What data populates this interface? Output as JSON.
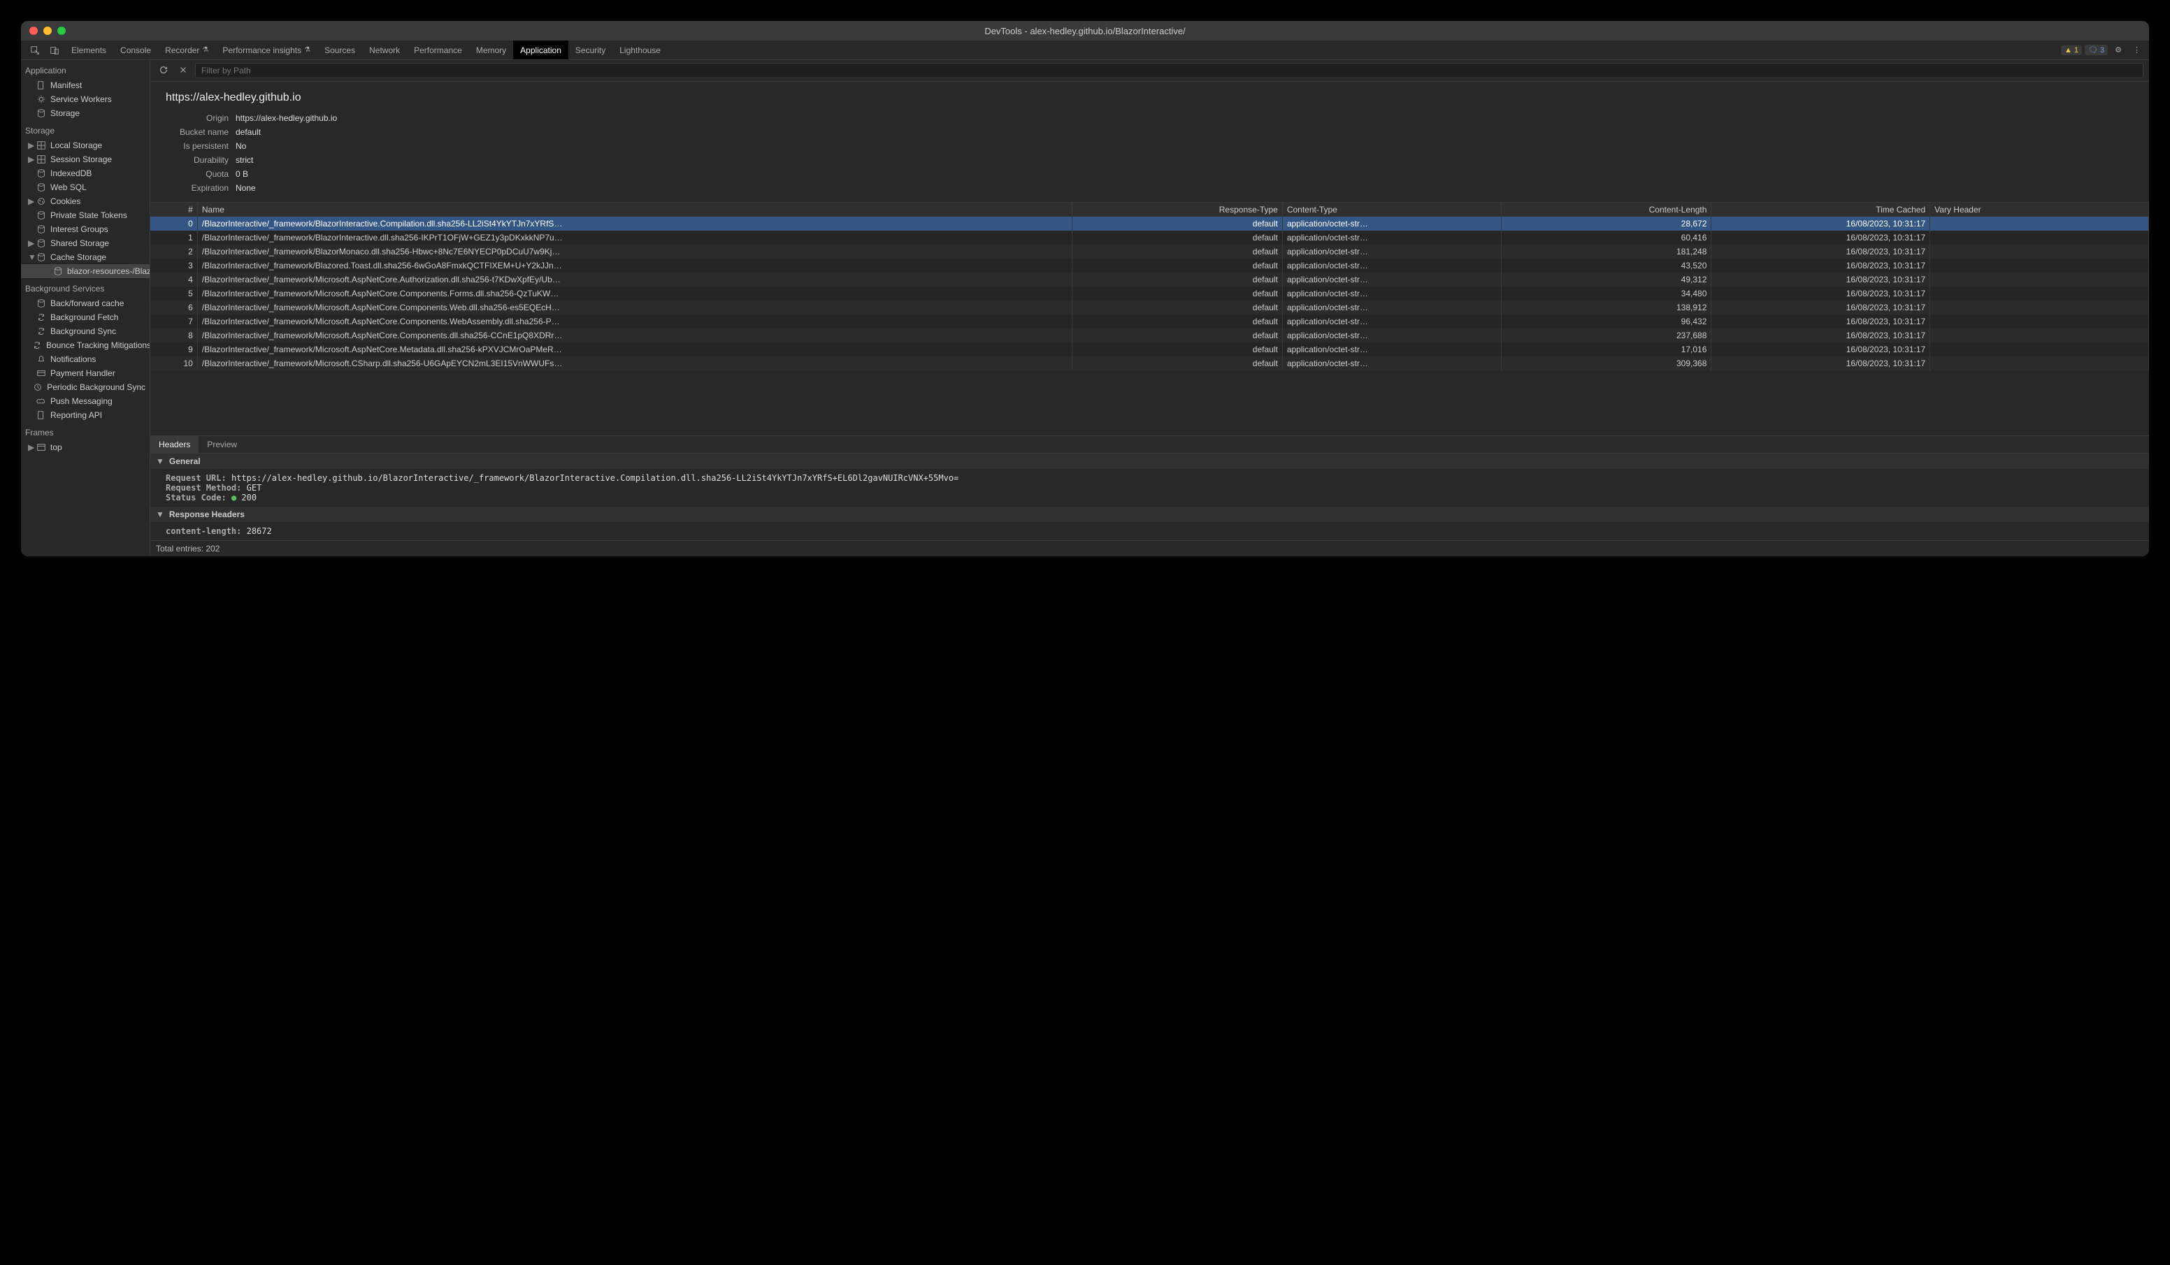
{
  "window": {
    "title": "DevTools - alex-hedley.github.io/BlazorInteractive/"
  },
  "tabs": {
    "items": [
      "Elements",
      "Console",
      "Recorder",
      "Performance insights",
      "Sources",
      "Network",
      "Performance",
      "Memory",
      "Application",
      "Security",
      "Lighthouse"
    ],
    "active": "Application",
    "warn_count": "1",
    "info_count": "3"
  },
  "filter": {
    "placeholder": "Filter by Path"
  },
  "origin": {
    "title": "https://alex-hedley.github.io",
    "fields": {
      "Origin": "https://alex-hedley.github.io",
      "Bucket name": "default",
      "Is persistent": "No",
      "Durability": "strict",
      "Quota": "0 B",
      "Expiration": "None"
    }
  },
  "sidebar": {
    "sections": {
      "application": {
        "label": "Application",
        "items": [
          {
            "label": "Manifest",
            "icon": "doc"
          },
          {
            "label": "Service Workers",
            "icon": "gear"
          },
          {
            "label": "Storage",
            "icon": "db"
          }
        ]
      },
      "storage": {
        "label": "Storage",
        "items": [
          {
            "label": "Local Storage",
            "icon": "grid",
            "disc": true
          },
          {
            "label": "Session Storage",
            "icon": "grid",
            "disc": true
          },
          {
            "label": "IndexedDB",
            "icon": "db"
          },
          {
            "label": "Web SQL",
            "icon": "db"
          },
          {
            "label": "Cookies",
            "icon": "cookie",
            "disc": true
          },
          {
            "label": "Private State Tokens",
            "icon": "db"
          },
          {
            "label": "Interest Groups",
            "icon": "db"
          },
          {
            "label": "Shared Storage",
            "icon": "db",
            "disc": true
          },
          {
            "label": "Cache Storage",
            "icon": "db",
            "disc": true,
            "open": true
          },
          {
            "label": "blazor-resources-/BlazorI",
            "icon": "db",
            "nested": true,
            "selected": true
          }
        ]
      },
      "bgservices": {
        "label": "Background Services",
        "items": [
          {
            "label": "Back/forward cache",
            "icon": "db"
          },
          {
            "label": "Background Fetch",
            "icon": "sync"
          },
          {
            "label": "Background Sync",
            "icon": "sync"
          },
          {
            "label": "Bounce Tracking Mitigations",
            "icon": "sync"
          },
          {
            "label": "Notifications",
            "icon": "bell"
          },
          {
            "label": "Payment Handler",
            "icon": "card"
          },
          {
            "label": "Periodic Background Sync",
            "icon": "clock"
          },
          {
            "label": "Push Messaging",
            "icon": "cloud"
          },
          {
            "label": "Reporting API",
            "icon": "doc"
          }
        ]
      },
      "frames": {
        "label": "Frames",
        "items": [
          {
            "label": "top",
            "icon": "window",
            "disc": true
          }
        ]
      }
    }
  },
  "table": {
    "columns": [
      "#",
      "Name",
      "Response-Type",
      "Content-Type",
      "Content-Length",
      "Time Cached",
      "Vary Header"
    ],
    "rows": [
      {
        "idx": "0",
        "name": "/BlazorInteractive/_framework/BlazorInteractive.Compilation.dll.sha256-LL2iSt4YkYTJn7xYRfS…",
        "rt": "default",
        "ct": "application/octet-str…",
        "cl": "28,672",
        "tc": "16/08/2023, 10:31:17",
        "vh": ""
      },
      {
        "idx": "1",
        "name": "/BlazorInteractive/_framework/BlazorInteractive.dll.sha256-IKPrT1OFjW+GEZ1y3pDKxkkNP7u…",
        "rt": "default",
        "ct": "application/octet-str…",
        "cl": "60,416",
        "tc": "16/08/2023, 10:31:17",
        "vh": ""
      },
      {
        "idx": "2",
        "name": "/BlazorInteractive/_framework/BlazorMonaco.dll.sha256-Hbwc+8Nc7E6NYECP0pDCuU7w9Kj…",
        "rt": "default",
        "ct": "application/octet-str…",
        "cl": "181,248",
        "tc": "16/08/2023, 10:31:17",
        "vh": ""
      },
      {
        "idx": "3",
        "name": "/BlazorInteractive/_framework/Blazored.Toast.dll.sha256-6wGoA8FmxkQCTFIXEM+U+Y2kJJn…",
        "rt": "default",
        "ct": "application/octet-str…",
        "cl": "43,520",
        "tc": "16/08/2023, 10:31:17",
        "vh": ""
      },
      {
        "idx": "4",
        "name": "/BlazorInteractive/_framework/Microsoft.AspNetCore.Authorization.dll.sha256-t7KDwXpfEy/Ub…",
        "rt": "default",
        "ct": "application/octet-str…",
        "cl": "49,312",
        "tc": "16/08/2023, 10:31:17",
        "vh": ""
      },
      {
        "idx": "5",
        "name": "/BlazorInteractive/_framework/Microsoft.AspNetCore.Components.Forms.dll.sha256-QzTuKW…",
        "rt": "default",
        "ct": "application/octet-str…",
        "cl": "34,480",
        "tc": "16/08/2023, 10:31:17",
        "vh": ""
      },
      {
        "idx": "6",
        "name": "/BlazorInteractive/_framework/Microsoft.AspNetCore.Components.Web.dll.sha256-es5EQEcH…",
        "rt": "default",
        "ct": "application/octet-str…",
        "cl": "138,912",
        "tc": "16/08/2023, 10:31:17",
        "vh": ""
      },
      {
        "idx": "7",
        "name": "/BlazorInteractive/_framework/Microsoft.AspNetCore.Components.WebAssembly.dll.sha256-P…",
        "rt": "default",
        "ct": "application/octet-str…",
        "cl": "96,432",
        "tc": "16/08/2023, 10:31:17",
        "vh": ""
      },
      {
        "idx": "8",
        "name": "/BlazorInteractive/_framework/Microsoft.AspNetCore.Components.dll.sha256-CCnE1pQ8XDRr…",
        "rt": "default",
        "ct": "application/octet-str…",
        "cl": "237,688",
        "tc": "16/08/2023, 10:31:17",
        "vh": ""
      },
      {
        "idx": "9",
        "name": "/BlazorInteractive/_framework/Microsoft.AspNetCore.Metadata.dll.sha256-kPXVJCMrOaPMeR…",
        "rt": "default",
        "ct": "application/octet-str…",
        "cl": "17,016",
        "tc": "16/08/2023, 10:31:17",
        "vh": ""
      },
      {
        "idx": "10",
        "name": "/BlazorInteractive/_framework/Microsoft.CSharp.dll.sha256-U6GApEYCN2mL3EI15VnWWUFs…",
        "rt": "default",
        "ct": "application/octet-str…",
        "cl": "309,368",
        "tc": "16/08/2023, 10:31:17",
        "vh": ""
      }
    ],
    "selected_index": 0
  },
  "subtabs": {
    "items": [
      "Headers",
      "Preview"
    ],
    "active": "Headers"
  },
  "details": {
    "general_label": "General",
    "request_url_label": "Request URL:",
    "request_url": "https://alex-hedley.github.io/BlazorInteractive/_framework/BlazorInteractive.Compilation.dll.sha256-LL2iSt4YkYTJn7xYRfS+EL6Dl2gavNUIRcVNX+55Mvo=",
    "request_method_label": "Request Method:",
    "request_method": "GET",
    "status_code_label": "Status Code:",
    "status_code": "200",
    "response_headers_label": "Response Headers",
    "content_length_label": "content-length:",
    "content_length": "28672"
  },
  "footer": {
    "total": "Total entries: 202"
  }
}
